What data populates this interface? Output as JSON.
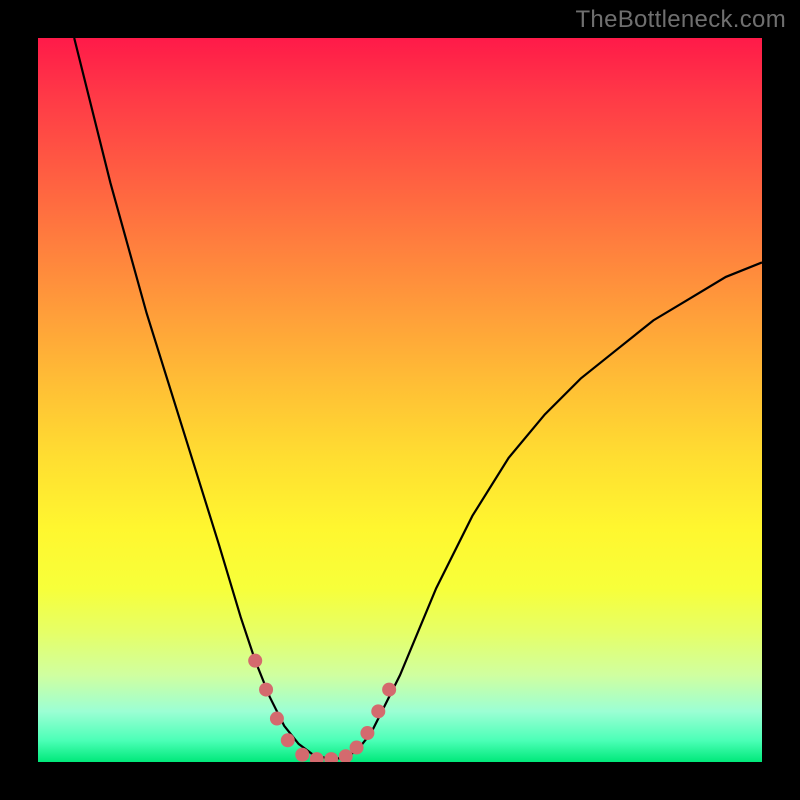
{
  "watermark": "TheBottleneck.com",
  "colors": {
    "frame": "#000000",
    "watermark": "#6f6f6f",
    "curve": "#000000",
    "dots_fill": "#d46a6e",
    "dots_stroke": "#c45a5f",
    "gradient_top": "#ff1a49",
    "gradient_bottom": "#00e97a"
  },
  "chart_data": {
    "type": "line",
    "title": "",
    "xlabel": "",
    "ylabel": "",
    "xlim": [
      0,
      100
    ],
    "ylim": [
      0,
      100
    ],
    "grid": false,
    "legend": false,
    "series": [
      {
        "name": "bottleneck-curve",
        "x": [
          5,
          10,
          15,
          20,
          25,
          28,
          30,
          32,
          34,
          36,
          38,
          40,
          42,
          44,
          46,
          50,
          55,
          60,
          65,
          70,
          75,
          80,
          85,
          90,
          95,
          100
        ],
        "y": [
          100,
          80,
          62,
          46,
          30,
          20,
          14,
          9,
          5,
          2.5,
          1,
          0.5,
          0.5,
          1.5,
          4,
          12,
          24,
          34,
          42,
          48,
          53,
          57,
          61,
          64,
          67,
          69
        ]
      }
    ],
    "dots": {
      "name": "highlight-dots",
      "points": [
        {
          "x": 30,
          "y": 14
        },
        {
          "x": 31.5,
          "y": 10
        },
        {
          "x": 33,
          "y": 6
        },
        {
          "x": 34.5,
          "y": 3
        },
        {
          "x": 36.5,
          "y": 1
        },
        {
          "x": 38.5,
          "y": 0.4
        },
        {
          "x": 40.5,
          "y": 0.4
        },
        {
          "x": 42.5,
          "y": 0.8
        },
        {
          "x": 44,
          "y": 2
        },
        {
          "x": 45.5,
          "y": 4
        },
        {
          "x": 47,
          "y": 7
        },
        {
          "x": 48.5,
          "y": 10
        }
      ],
      "radius": 7
    }
  }
}
